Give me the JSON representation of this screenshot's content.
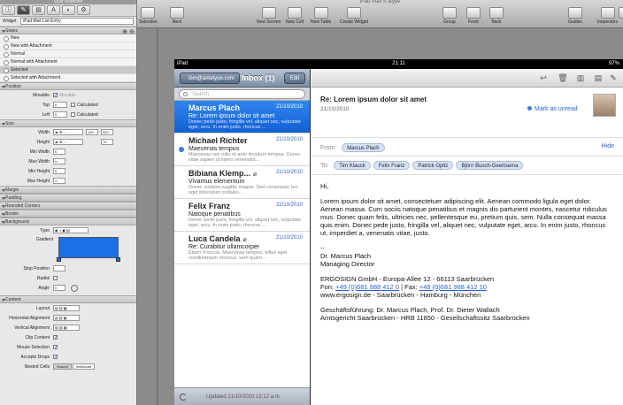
{
  "app": {
    "doc_title": "iPad Mail 5.atype",
    "inspector_title": "Style Inspector"
  },
  "toolbar": {
    "left": [
      {
        "label": "Selection"
      },
      {
        "label": "Next"
      }
    ],
    "center": [
      {
        "label": "New Screen"
      },
      {
        "label": "New Cell"
      },
      {
        "label": "New Table"
      },
      {
        "label": "Create Widget"
      }
    ],
    "right": [
      {
        "label": "Group"
      },
      {
        "label": "Front"
      },
      {
        "label": "Back"
      }
    ],
    "far": [
      {
        "label": "Guides"
      },
      {
        "label": "Inspectors"
      },
      {
        "label": "El"
      }
    ]
  },
  "inspector": {
    "widget_label": "Widget",
    "widget_value": "iPad Mail List Entry",
    "states_title": "States",
    "states": [
      "New",
      "New with Attachment",
      "Normal",
      "Normal with Attachment",
      "Selected",
      "Selected with Attachment"
    ],
    "selected_state": "Selected",
    "position_title": "Position",
    "movable_label": "Movable",
    "movable_text": "Movable",
    "top_label": "Top",
    "left_label": "Left",
    "calculated": "Calculated",
    "size_title": "Size",
    "width_label": "Width",
    "height_label": "Height",
    "width_value": "100",
    "width_value2": "320",
    "height_value": "76",
    "min_width": "Min Width",
    "max_width": "Max Width",
    "min_height": "Min Height",
    "max_height": "Max Height",
    "sections": [
      "Margin",
      "Padding",
      "Rounded Corners",
      "Border"
    ],
    "background_title": "Background",
    "type_label": "Type",
    "gradient_label": "Gradient",
    "gradient_color": "#1d6fe8",
    "stop_position": "Stop Position",
    "radial": "Radial",
    "angle": "Angle",
    "content_title": "Content",
    "content_rows": [
      "Layout",
      "Horizontal Alignment",
      "Vertical Alignment",
      "Clip Content",
      "Mouse Selection",
      "Accepts Drops",
      "Nested Cells"
    ],
    "nested_options": [
      "Shared",
      "Individual"
    ]
  },
  "ipad": {
    "status": {
      "carrier": "iPad",
      "time": "21:11",
      "battery": "97%"
    },
    "master": {
      "back_label": "ibm@antetype.com",
      "title": "Inbox (1)",
      "edit_label": "Edit",
      "search_placeholder": "Search",
      "messages": [
        {
          "sender": "Marcus Plach",
          "date": "21/10/2010",
          "subject": "Re: Lorem ipsum dolor sit amet",
          "preview": "Donec pede justo, fringilla vel, aliquet nec, vulputate eget, arcu. In enim justo, rhoncus ...",
          "selected": true,
          "unread": false,
          "attachment": false
        },
        {
          "sender": "Michael Richter",
          "date": "21/10/2010",
          "subject": "Maecenas tempus",
          "preview": "Maecenas nec odio et ante tincidunt tempus. Donec vitae sapien ut libero venenatis...",
          "selected": false,
          "unread": true,
          "attachment": false
        },
        {
          "sender": "Bibiana Klemp...",
          "date": "21/10/2010",
          "subject": "Vivamus elementum",
          "preview": "Donec sodales sagittis magna. Sed consequat, leo eget bibendum sodales...",
          "selected": false,
          "unread": false,
          "attachment": true
        },
        {
          "sender": "Felix Franz",
          "date": "22/10/2010",
          "subject": "Natoque penatibus",
          "preview": "Donec pede justo, fringilla vel, aliquet nec, vulputate eget, arcu. In enim justo, rhoncus ...",
          "selected": false,
          "unread": false,
          "attachment": false
        },
        {
          "sender": "Luca Candela",
          "date": "21/10/2010",
          "subject": "Re: Curabitur ullamcorper",
          "preview": "Etiam rhoncus. Maecenas tempus, tellus eget condimentum rhoncus, sem quam...",
          "selected": false,
          "unread": false,
          "attachment": true
        }
      ],
      "footer": "Updated 21/10/2010 12:12 a.m."
    },
    "detail": {
      "subject": "Re: Lorem ipsum dolor sit amet",
      "date": "21/10/2010",
      "mark_unread": "Mark as unread",
      "from_label": "From:",
      "from": "Marcus Plach",
      "hide": "Hide",
      "to_label": "To:",
      "to": [
        "Tim Klauck",
        "Felix Franz",
        "Patrick Opitz",
        "Björn Busch-Geertsema"
      ],
      "greeting": "Hi,",
      "paragraph": "Lorem ipsum dolor sit amet, consectetuer adipiscing elit. Aenean commodo ligula eget dolor. Aenean massa. Cum sociis natoque penatibus et magnis dis parturient montes, nascetur ridiculus mus. Donec quam felis, ultricies nec, pellentesque eu, pretium quis, sem. Nulla consequat massa quis enim. Donec pede justo, fringilla vel, aliquet nec, vulputate eget, arcu. In enim justo, rhoncus ut, imperdiet a, venenatis vitae, justo.",
      "sig_sep": "--",
      "sig_name": "Dr. Marcus Plach",
      "sig_role": "Managing Director",
      "company": "ERGOSIGN GmbH - Europa-Allee 12 - 66113 Saarbrücken",
      "fon_label": "Fon: ",
      "fon": "+49 (0)681 988 412 0",
      "fax_label": " | Fax: ",
      "fax": "+49 (0)681 988 412 10",
      "web": "www.ergosign.de - Saarbrücken - Hamburg - München",
      "gf": "Geschäftsführung: Dr. Marcus Plach, Prof. Dr. Dieter Wallach",
      "ag": "Amtsgericht Saarbrücken - HRB 11850 - Gesellschaftssitz Saarbrücken"
    }
  }
}
